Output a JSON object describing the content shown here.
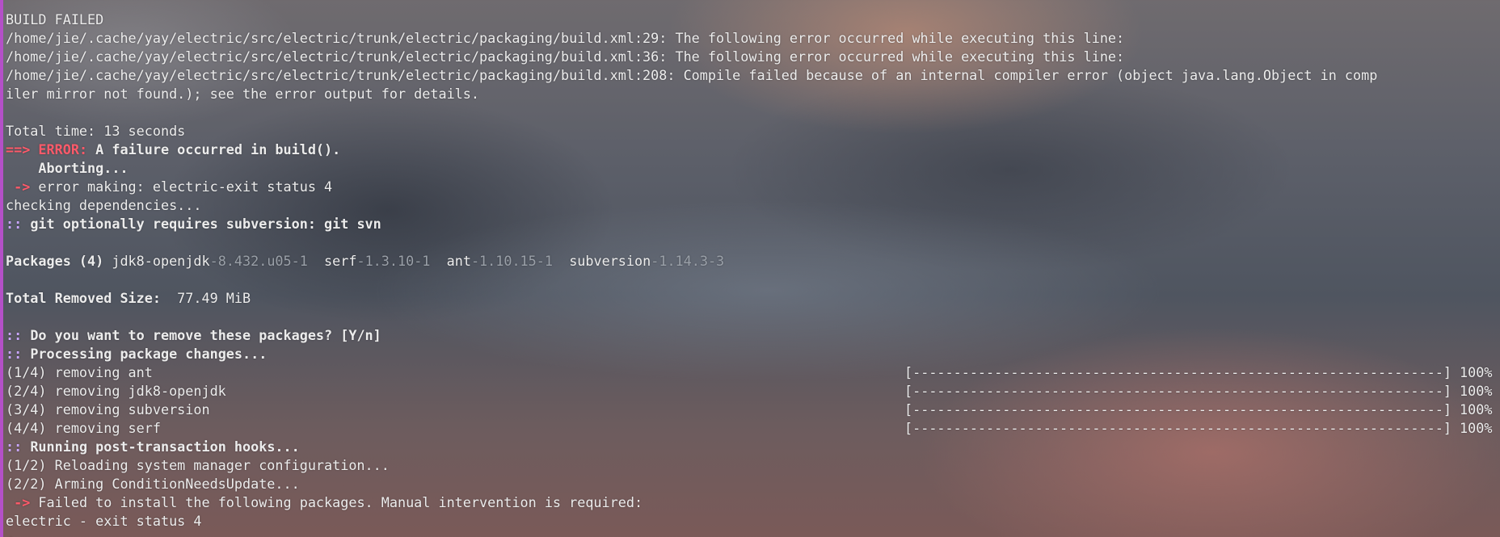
{
  "colors": {
    "window_border": "#b450c8",
    "prompt_prefix": "#c9a6ff",
    "error": "#ff5a6a",
    "version_dim": "#9aa0a8",
    "shell_prompt": "#f0a030"
  },
  "lines": {
    "l01": "BUILD FAILED",
    "l02": "/home/jie/.cache/yay/electric/src/electric/trunk/electric/packaging/build.xml:29: The following error occurred while executing this line:",
    "l03": "/home/jie/.cache/yay/electric/src/electric/trunk/electric/packaging/build.xml:36: The following error occurred while executing this line:",
    "l04": "/home/jie/.cache/yay/electric/src/electric/trunk/electric/packaging/build.xml:208: Compile failed because of an internal compiler error (object java.lang.Object in comp",
    "l05": "iler mirror not found.); see the error output for details.",
    "l07": "Total time: 13 seconds",
    "l08_prefix": "==> ",
    "l08_error": "ERROR:",
    "l08_msg": " A failure occurred in build().",
    "l09": "    Aborting...",
    "l10_arrow": " -> ",
    "l10_msg": "error making: electric-exit status 4",
    "l11": "checking dependencies...",
    "l12_prefix": "::",
    "l12_msg": " git optionally requires subversion: git svn",
    "l14_label": "Packages (4)",
    "packages": [
      {
        "name": " jdk8-openjdk",
        "version": "-8.432.u05-1"
      },
      {
        "name": "  serf",
        "version": "-1.3.10-1"
      },
      {
        "name": "  ant",
        "version": "-1.10.15-1"
      },
      {
        "name": "  subversion",
        "version": "-1.14.3-3"
      }
    ],
    "l16_label": "Total Removed Size:",
    "l16_value": "  77.49 MiB",
    "l18_prefix": "::",
    "l18_msg": " Do you want to remove these packages? [Y/n]",
    "l19_prefix": "::",
    "l19_msg": " Processing package changes...",
    "progress": [
      {
        "text": "(1/4) removing ant",
        "percent_text": "100%",
        "percent": 100
      },
      {
        "text": "(2/4) removing jdk8-openjdk",
        "percent_text": "100%",
        "percent": 100
      },
      {
        "text": "(3/4) removing subversion",
        "percent_text": "100%",
        "percent": 100
      },
      {
        "text": "(4/4) removing serf",
        "percent_text": "100%",
        "percent": 100
      }
    ],
    "l24_prefix": "::",
    "l24_msg": " Running post-transaction hooks...",
    "l25": "(1/2) Reloading system manager configuration...",
    "l26": "(2/2) Arming ConditionNeedsUpdate...",
    "l27_arrow": " -> ",
    "l27_msg": "Failed to install the following packages. Manual intervention is required:",
    "l28": "electric - exit status 4"
  }
}
